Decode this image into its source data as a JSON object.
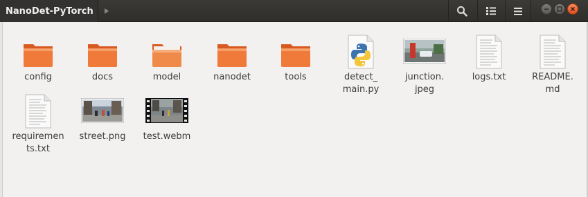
{
  "window": {
    "title": "NanoDet-PyTorch",
    "toolbar": {
      "search_icon": "search-icon",
      "view_icon": "list-view-icon",
      "menu_icon": "hamburger-menu-icon"
    }
  },
  "files": [
    {
      "name": "config",
      "kind": "folder"
    },
    {
      "name": "docs",
      "kind": "folder"
    },
    {
      "name": "model",
      "kind": "folder"
    },
    {
      "name": "nanodet",
      "kind": "folder"
    },
    {
      "name": "tools",
      "kind": "folder"
    },
    {
      "name": "detect_\nmain.py",
      "kind": "python"
    },
    {
      "name": "junction.\njpeg",
      "kind": "image"
    },
    {
      "name": "logs.txt",
      "kind": "text"
    },
    {
      "name": "README.\nmd",
      "kind": "text"
    },
    {
      "name": "requiremen\nts.txt",
      "kind": "text"
    },
    {
      "name": "street.png",
      "kind": "image"
    },
    {
      "name": "test.webm",
      "kind": "video"
    }
  ],
  "colors": {
    "folder_front": "#ef7a3a",
    "folder_back": "#d85a21",
    "headerbar": "#2f2e2a",
    "background": "#f2f1f0"
  }
}
